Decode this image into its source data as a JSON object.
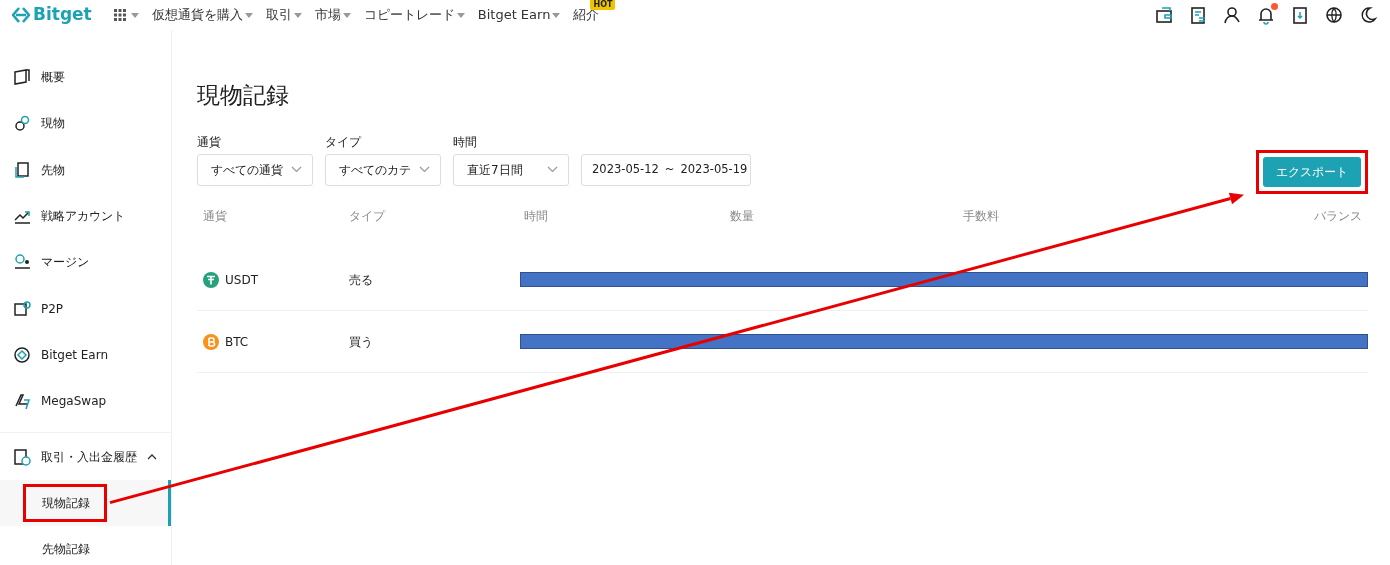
{
  "navbar": {
    "logo": "Bitget",
    "menu": [
      {
        "label": "仮想通貨を購入",
        "caret": true
      },
      {
        "label": "取引",
        "caret": true
      },
      {
        "label": "市場",
        "caret": true
      },
      {
        "label": "コピートレード",
        "caret": true
      },
      {
        "label": "Bitget Earn",
        "caret": true
      },
      {
        "label": "紹介",
        "caret": false,
        "badge": "HOT"
      }
    ],
    "notification_dot": true
  },
  "sidebar": {
    "items": [
      {
        "label": "概要"
      },
      {
        "label": "現物"
      },
      {
        "label": "先物"
      },
      {
        "label": "戦略アカウント"
      },
      {
        "label": "マージン"
      },
      {
        "label": "P2P"
      },
      {
        "label": "Bitget Earn"
      },
      {
        "label": "MegaSwap"
      },
      {
        "label": "取引・入出金履歴",
        "expanded": true,
        "children": [
          {
            "label": "現物記録",
            "selected": true,
            "highlighted": true
          },
          {
            "label": "先物記録",
            "selected": false,
            "highlighted": false
          }
        ]
      }
    ]
  },
  "page": {
    "title": "現物記録",
    "filters": [
      {
        "label": "通貨",
        "value": "すべての通貨"
      },
      {
        "label": "タイプ",
        "value": "すべてのカテ"
      },
      {
        "label": "時間",
        "value": "直近7日間"
      }
    ],
    "date_range": {
      "start": "2023-05-12",
      "separator": "~",
      "end": "2023-05-19"
    },
    "export_button": {
      "label": "エクスポート",
      "highlighted": true
    },
    "table": {
      "columns": [
        "通貨",
        "タイプ",
        "時間",
        "数量",
        "手数料",
        "バランス"
      ],
      "rows": [
        {
          "coin": "USDT",
          "color": "#26a17b",
          "type": "売る",
          "redacted": true
        },
        {
          "coin": "BTC",
          "color": "#f7931a",
          "type": "買う",
          "redacted": true
        }
      ]
    }
  },
  "annotation": {
    "arrow": true
  }
}
